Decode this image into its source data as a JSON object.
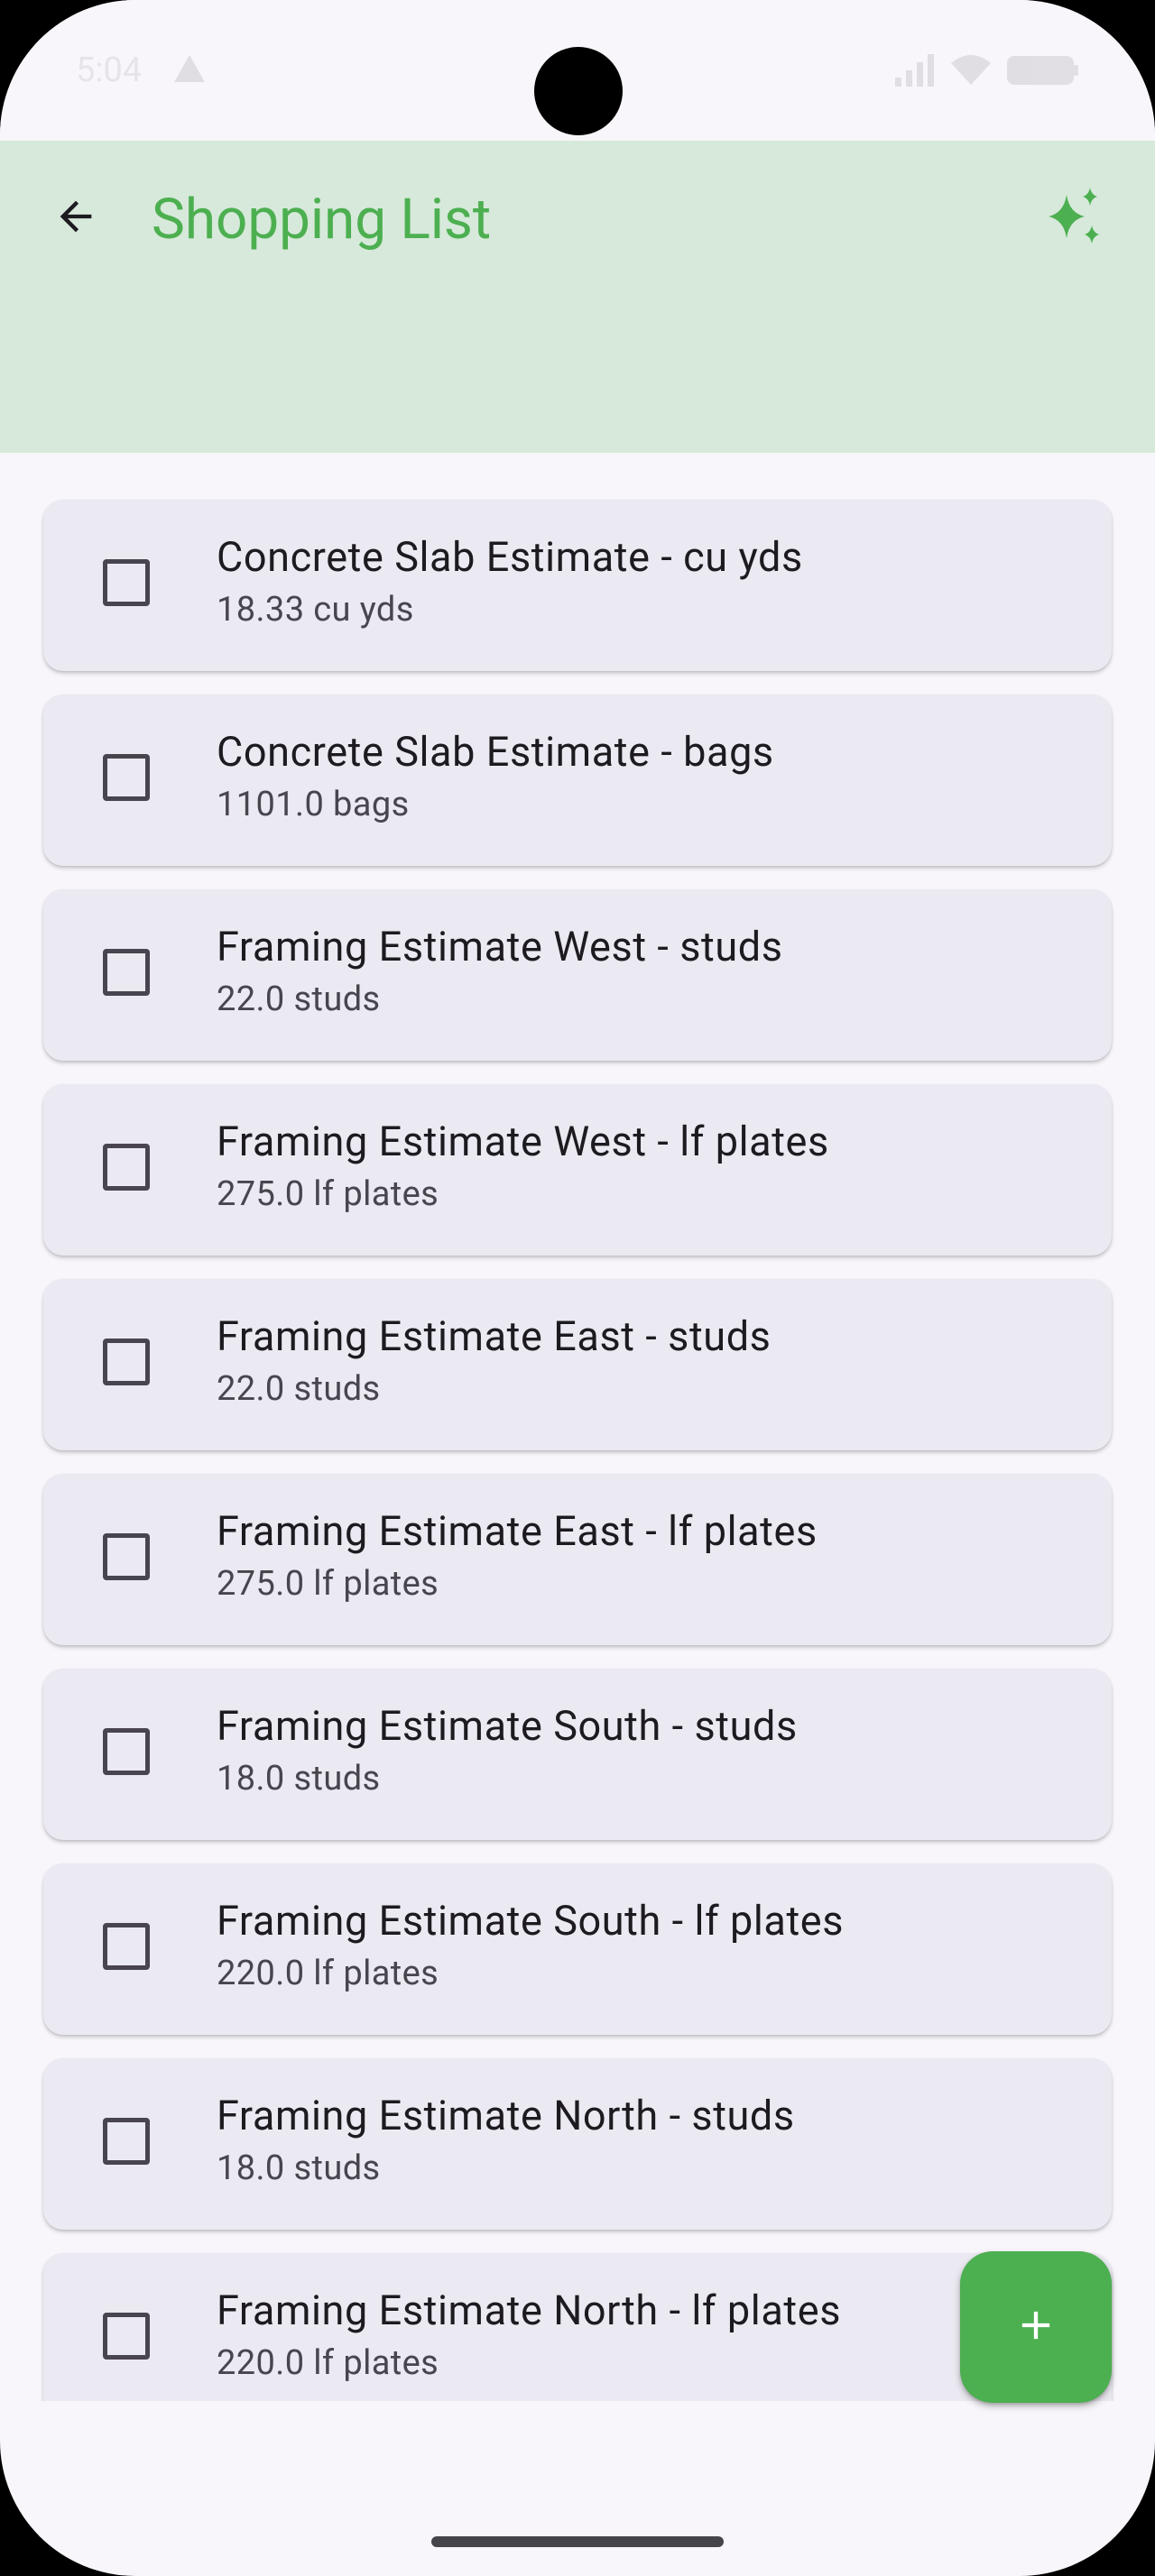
{
  "status_bar": {
    "time": "5:04"
  },
  "app_bar": {
    "title": "Shopping List",
    "back_icon": "arrow-back-icon",
    "action_icon": "sparkles-icon",
    "accent_color": "#4caf50",
    "background_color": "#d6e9da"
  },
  "items": [
    {
      "title": "Concrete Slab Estimate - cu yds",
      "subtitle": "18.33 cu yds",
      "checked": false
    },
    {
      "title": "Concrete Slab Estimate - bags",
      "subtitle": "1101.0 bags",
      "checked": false
    },
    {
      "title": "Framing Estimate West - studs",
      "subtitle": "22.0 studs",
      "checked": false
    },
    {
      "title": "Framing Estimate West - lf plates",
      "subtitle": "275.0 lf plates",
      "checked": false
    },
    {
      "title": "Framing Estimate East - studs",
      "subtitle": "22.0 studs",
      "checked": false
    },
    {
      "title": "Framing Estimate East - lf plates",
      "subtitle": "275.0 lf plates",
      "checked": false
    },
    {
      "title": "Framing Estimate South - studs",
      "subtitle": "18.0 studs",
      "checked": false
    },
    {
      "title": "Framing Estimate South - lf plates",
      "subtitle": "220.0 lf plates",
      "checked": false
    },
    {
      "title": "Framing Estimate North - studs",
      "subtitle": "18.0 studs",
      "checked": false
    },
    {
      "title": "Framing Estimate North - lf plates",
      "subtitle": "220.0 lf plates",
      "checked": false
    }
  ],
  "fab": {
    "icon": "plus-icon"
  }
}
